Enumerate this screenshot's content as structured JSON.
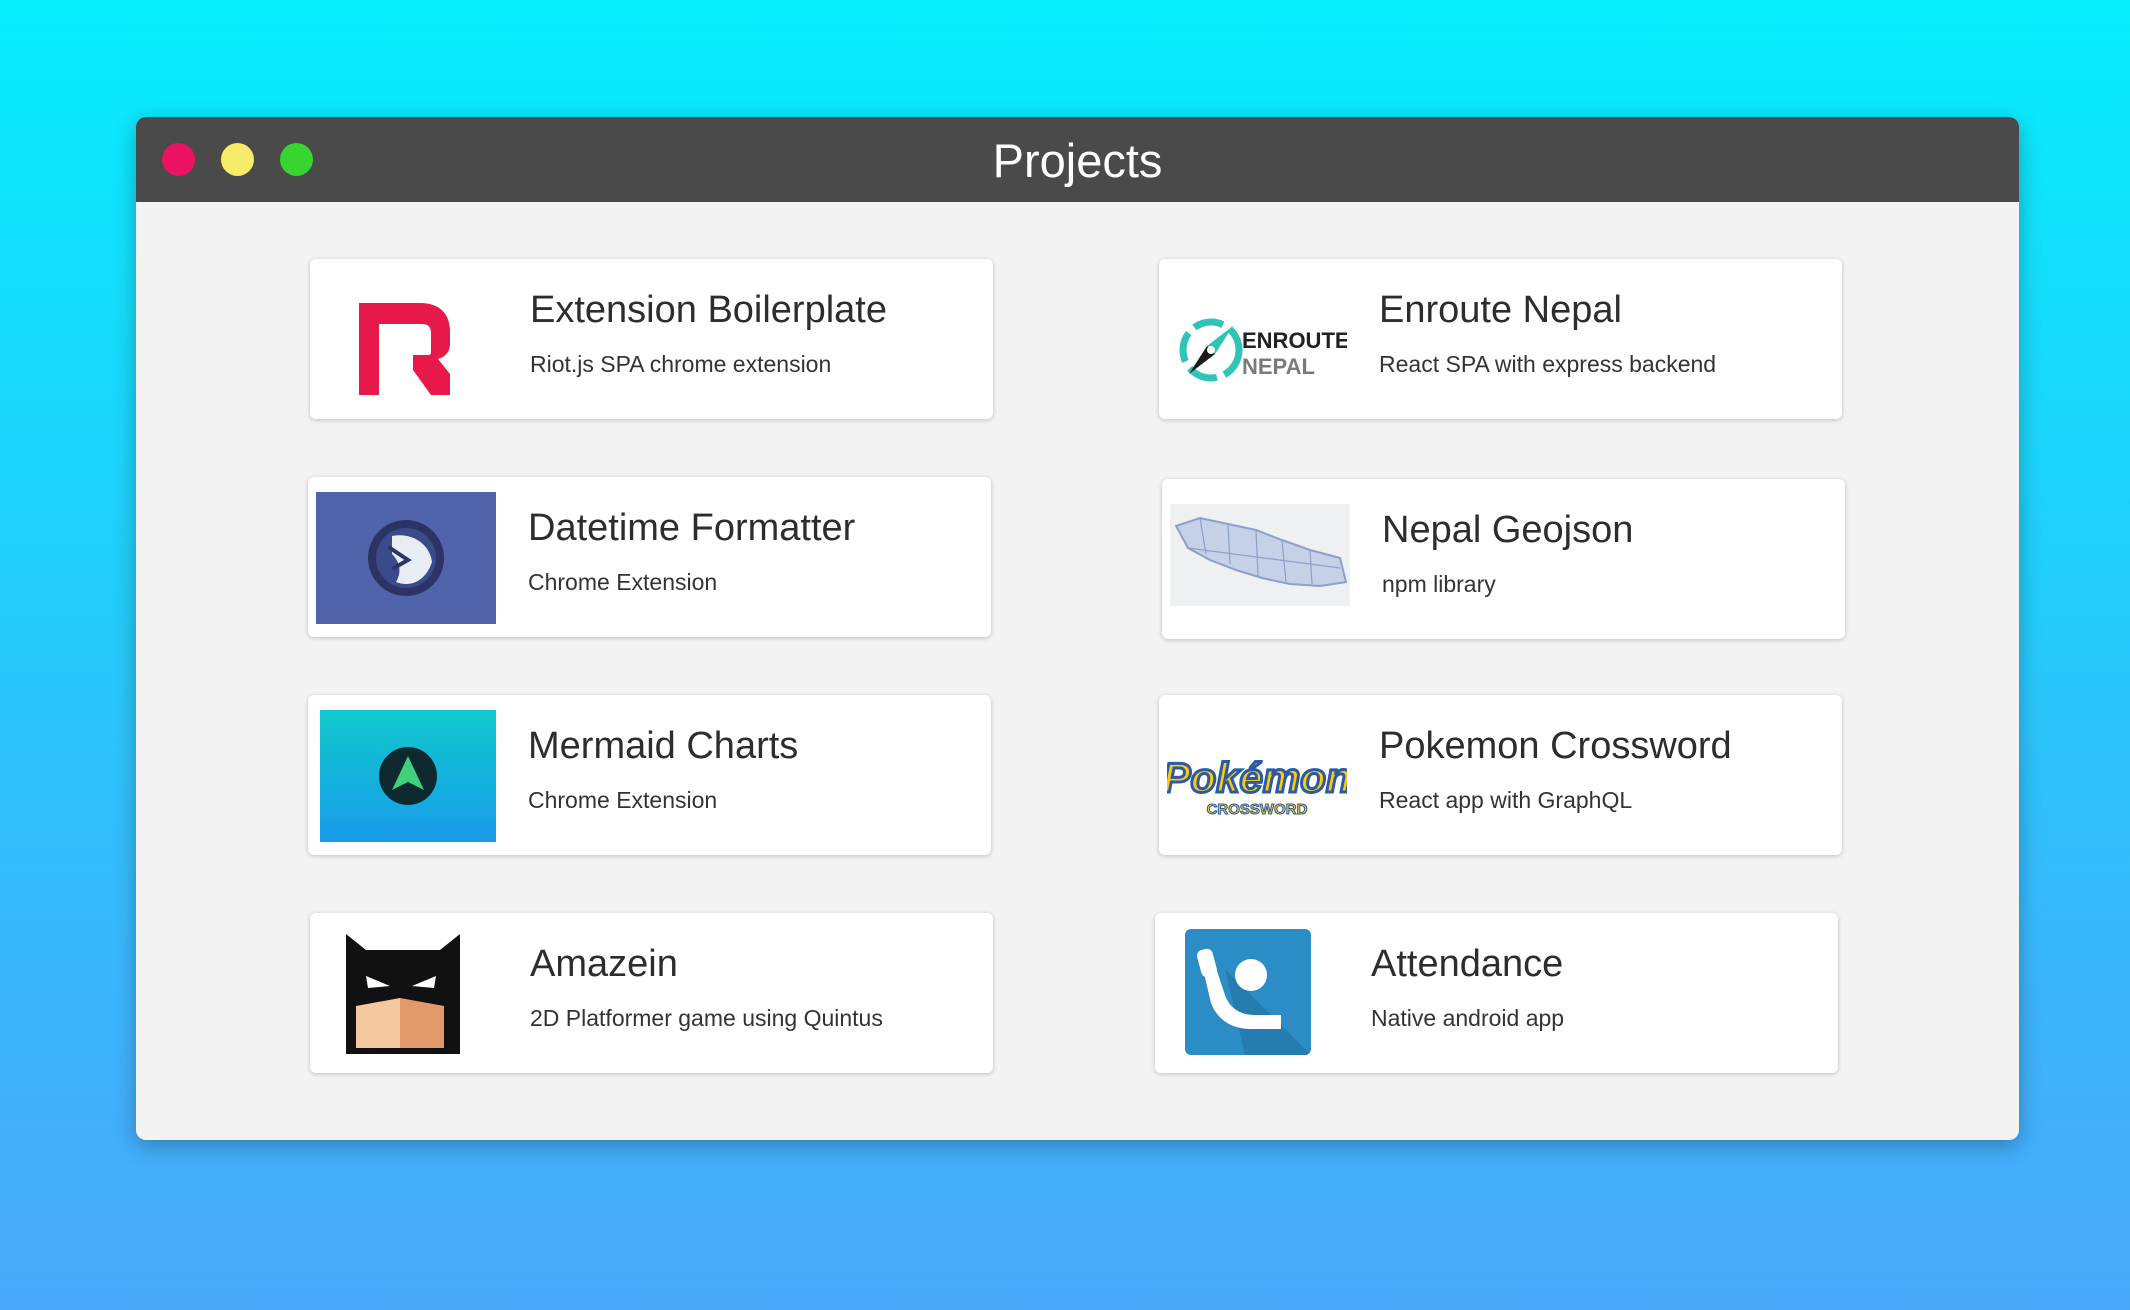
{
  "window": {
    "title": "Projects"
  },
  "colors": {
    "background_top": "#06eefc",
    "background_bottom": "#4aa8fb",
    "titlebar": "#4a4a4a",
    "close_dot": "#ec1161",
    "minimize_dot": "#f5ec6a",
    "maximize_dot": "#38d430"
  },
  "projects": [
    {
      "name": "Extension Boilerplate",
      "description": "Riot.js SPA chrome extension",
      "icon": "riot-logo-icon"
    },
    {
      "name": "Enroute Nepal",
      "description": "React SPA with express backend",
      "icon": "enroute-nepal-logo-icon",
      "logo_text": [
        "ENROUTE",
        "NEPAL"
      ]
    },
    {
      "name": "Datetime Formatter",
      "description": "Chrome Extension",
      "icon": "clock-globe-icon"
    },
    {
      "name": "Nepal Geojson",
      "description": "npm library",
      "icon": "nepal-map-icon"
    },
    {
      "name": "Mermaid Charts",
      "description": "Chrome Extension",
      "icon": "mermaid-logo-icon"
    },
    {
      "name": "Pokemon Crossword",
      "description": "React app with GraphQL",
      "icon": "pokemon-crossword-logo-icon",
      "logo_text": [
        "Pokémon",
        "CROSSWORD"
      ]
    },
    {
      "name": "Amazein",
      "description": "2D Platformer game using Quintus",
      "icon": "batman-mask-icon"
    },
    {
      "name": "Attendance",
      "description": "Native android app",
      "icon": "raised-hand-icon"
    }
  ]
}
